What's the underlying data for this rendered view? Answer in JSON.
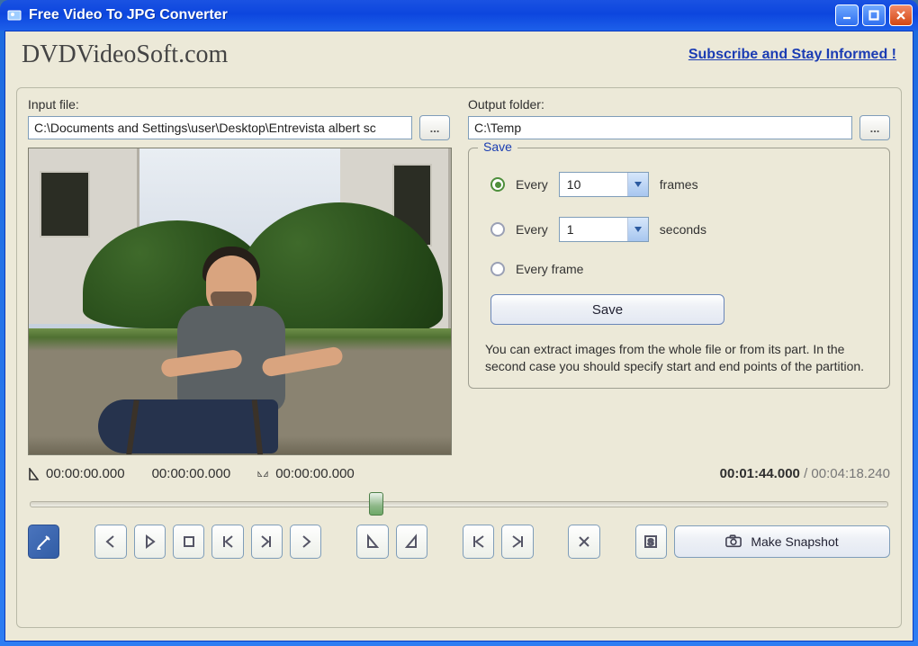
{
  "window": {
    "title": "Free Video To JPG Converter"
  },
  "header": {
    "brand": "DVDVideoSoft.com",
    "subscribe": "Subscribe and Stay Informed !"
  },
  "input": {
    "label": "Input file:",
    "value": "C:\\Documents and Settings\\user\\Desktop\\Entrevista albert sc",
    "browse": "..."
  },
  "output": {
    "label": "Output folder:",
    "value": "C:\\Temp",
    "browse": "..."
  },
  "save": {
    "legend": "Save",
    "opt_frames": {
      "label": "Every",
      "value": "10",
      "unit": "frames",
      "checked": true
    },
    "opt_seconds": {
      "label": "Every",
      "value": "1",
      "unit": "seconds",
      "checked": false
    },
    "opt_every_frame": {
      "label": "Every frame",
      "checked": false
    },
    "save_btn": "Save",
    "help": "You can extract images from the whole file or from its part. In the second case you should specify start and end points of the partition."
  },
  "times": {
    "start": "00:00:00.000",
    "mid": "00:00:00.000",
    "end": "00:00:00.000",
    "current": "00:01:44.000",
    "duration": "00:04:18.240",
    "seek_percent": 40.3
  },
  "snapshot": {
    "label": "Make Snapshot"
  }
}
